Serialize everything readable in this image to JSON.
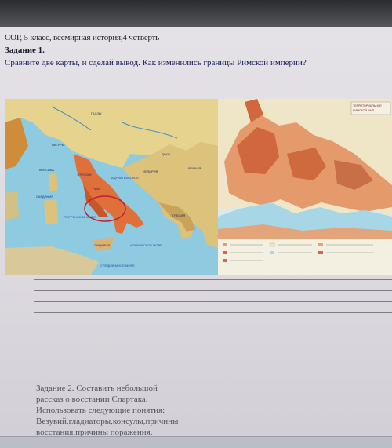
{
  "header": {
    "line1": "СОР, 5 класс, всемирная история,4 четверть",
    "line2": "Задание 1.",
    "line3": "Сравните две карты, и сделай вывод. Как изменились границы Римской империи?"
  },
  "map_left": {
    "labels": [
      "ГАЛЛЫ",
      "ЛИГУРЫ",
      "ЭТРУСКИ",
      "РИМ",
      "КОРСИКА",
      "САРДИНИЯ",
      "ТИРРЕНСКОЕ МОРЕ",
      "СИЦИЛИЯ",
      "ИЛЛИРИЯ",
      "ГРЕЦИЯ",
      "ИОНИЧЕСКОЕ МОРЕ",
      "СРЕДИЗЕМНОЕ МОРЕ",
      "АДРИАТИЧЕСКОЕ",
      "ФРАКИЯ",
      "ДАКИ"
    ]
  },
  "map_right": {
    "title_line1": "ТЕРРИТОРИАЛЬНОЕ",
    "title_line2": "РИМСКОЙ ИМП..."
  },
  "task2": {
    "lines": [
      "Задание 2. Составить небольшой",
      "рассказ о восстании Спартака.",
      "Использовать следующие понятия:",
      "Везувий,гладиаторы,консулы,причины",
      "восстания,причины поражения."
    ]
  }
}
